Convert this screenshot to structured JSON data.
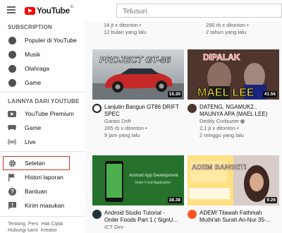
{
  "header": {
    "logo_text": "YouTube",
    "country_code": "ID",
    "search_placeholder": "Telusuri"
  },
  "sidebar": {
    "subscription_title": "SUBSCRIPTION",
    "subscriptions": [
      {
        "label": "Populer di YouTube",
        "icon": "popular-channel-icon"
      },
      {
        "label": "Musik",
        "icon": "music-channel-icon"
      },
      {
        "label": "Olahraga",
        "icon": "sports-channel-icon"
      },
      {
        "label": "Game",
        "icon": "gaming-channel-icon"
      }
    ],
    "more_title": "LAINNYA DARI YOUTUBE",
    "more": [
      {
        "label": "YouTube Premium",
        "icon": "youtube-premium-icon"
      },
      {
        "label": "Game",
        "icon": "gaming-icon"
      },
      {
        "label": "Live",
        "icon": "live-icon"
      }
    ],
    "settings": [
      {
        "label": "Setelan",
        "icon": "gear-icon"
      },
      {
        "label": "Histori laporan",
        "icon": "flag-icon"
      },
      {
        "label": "Bantuan",
        "icon": "help-icon"
      },
      {
        "label": "Kirim masukan",
        "icon": "feedback-icon"
      }
    ],
    "footer_links": [
      "Tentang",
      "Pers",
      "Hak Cipta",
      "Hubungi kami",
      "Kreator"
    ],
    "highlight_color": "#d32f2f"
  },
  "top_row_meta": [
    {
      "views": "14 jt x ditonton •",
      "age": "12 bulan yang lalu"
    },
    {
      "views": "290 rb x ditonton •",
      "age": "2 tahun yang lalu"
    }
  ],
  "videos": [
    {
      "thumb_text": "PROJECT GT-86",
      "duration": "15.30",
      "title_line1": "Lanjutin Bangun GT86 DRIFT",
      "title_line2": "SPEC",
      "channel": "Garasi Drift",
      "views": "285 rb x ditonton •",
      "age": "9 jam yang lalu"
    },
    {
      "thumb_text_top": "DIPALAK",
      "thumb_text_bottom": "MAEL LEE",
      "duration": "41.56",
      "title_line1": "DATENG, NGAMUK2..",
      "title_line2": "MAUNYA APA (MAEL LEE)",
      "channel": "Deddy Corbuzier",
      "views": "2,1 jt x ditonton •",
      "age": "2 minggu yang lalu"
    },
    {
      "thumb_text": "Android App Development",
      "thumb_sub": "Order Food Application",
      "duration": "38.38",
      "title_line1": "Android Studio Tutorial -",
      "title_line2": "Order Foods Part 1 ( SignU...",
      "channel": "ICT Dev"
    },
    {
      "thumb_text": "ADEM BANGET!",
      "duration": "9.26",
      "title_line1": "ADEM! Tilawah Fathmah",
      "title_line2": "Muthi'ah Surah An-Nur 35-..."
    }
  ]
}
